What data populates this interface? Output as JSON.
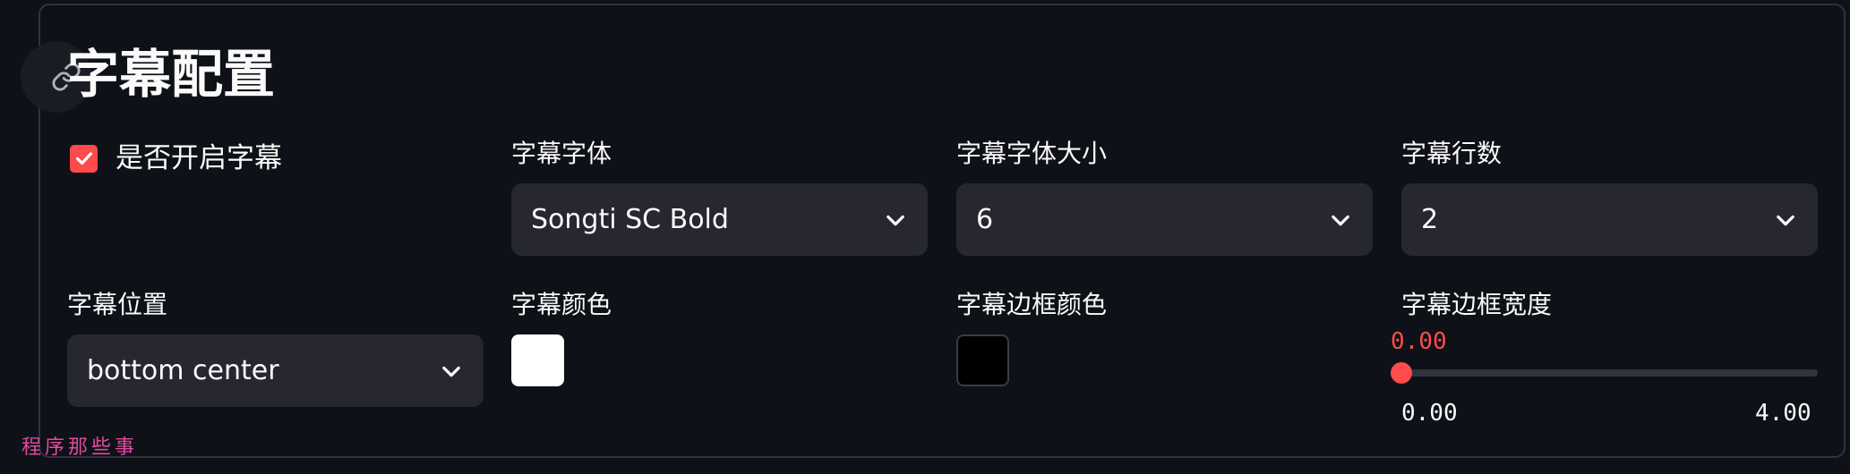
{
  "section": {
    "title": "字幕配置"
  },
  "enable_subtitles": {
    "label": "是否开启字幕",
    "checked": true
  },
  "font": {
    "label": "字幕字体",
    "value": "Songti SC Bold"
  },
  "font_size": {
    "label": "字幕字体大小",
    "value": "6"
  },
  "line_count": {
    "label": "字幕行数",
    "value": "2"
  },
  "position": {
    "label": "字幕位置",
    "value": "bottom center"
  },
  "color": {
    "label": "字幕颜色",
    "value": "#ffffff"
  },
  "border_color": {
    "label": "字幕边框颜色",
    "value": "#000000"
  },
  "border_width": {
    "label": "字幕边框宽度",
    "value": "0.00",
    "min": "0.00",
    "max": "4.00",
    "fraction": 0
  },
  "watermark": "程序那些事",
  "colors": {
    "accent": "#ff4b4b",
    "background": "#0e1117",
    "input_bg": "#262730"
  }
}
